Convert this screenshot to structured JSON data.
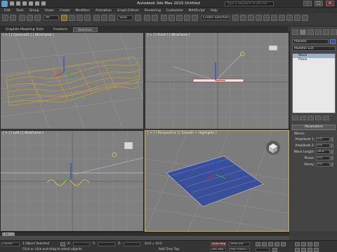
{
  "app": {
    "title": "Autodesk 3ds Max  2010      Untitled",
    "search_placeholder": "Type a keyword or phrase"
  },
  "window_controls": {
    "minimize": "–",
    "maximize": "□",
    "close": "×"
  },
  "menus": [
    "Edit",
    "Tools",
    "Group",
    "Views",
    "Create",
    "Modifiers",
    "Animation",
    "Graph Editors",
    "Rendering",
    "Customize",
    "MAXScript",
    "Help"
  ],
  "toolbar": {
    "selection_filter": "All",
    "view_dropdown": "View",
    "named_selection": "Create Selection Set"
  },
  "ribbon": {
    "tabs": [
      "Graphite Modeling Tools",
      "Freeform",
      "Selection"
    ],
    "selected_index": 2
  },
  "viewports": {
    "top": {
      "label": "[ + ] [ Camera01 ] [ Wireframe ]"
    },
    "front": {
      "label": "[ + ] [ Front ] [ Wireframe ]"
    },
    "left": {
      "label": "[ + ] [ Left ] [ Wireframe ]"
    },
    "perspective": {
      "label": "[ + ] [ Perspective ] [ Smooth + Highlights ]"
    }
  },
  "command_panel": {
    "object_name": "Plane01",
    "modifier_list": "Modifier List",
    "stack": [
      "Wave",
      "Plane"
    ],
    "selected_stack_index": 0,
    "rollout_title": "Parameters",
    "section_label": "Waves",
    "params": [
      {
        "label": "Amplitude 1:",
        "value": "6.0"
      },
      {
        "label": "Amplitude 2:",
        "value": "6.0"
      },
      {
        "label": "Wave Length:",
        "value": "50.0"
      },
      {
        "label": "Phase:",
        "value": "0.0"
      },
      {
        "label": "Decay:",
        "value": "0.0"
      }
    ]
  },
  "timeline": {
    "frame": "0 / 100"
  },
  "status": {
    "maxscript": "Planes",
    "selection": "1 Object Selected",
    "prompt": "Click or click-and-drag to select objects",
    "add_time_tag": "Add Time Tag",
    "x": "X:",
    "y": "Y:",
    "z": "Z:",
    "grid": "Grid = 10.0",
    "auto_key": "Auto Key",
    "set_key": "Set Key",
    "selected_label": "Selected",
    "key_filters": "Key Filters..."
  }
}
